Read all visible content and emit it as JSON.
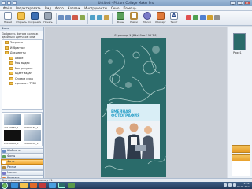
{
  "window": {
    "title": "Untitled - Picture Collage Maker Pro"
  },
  "menubar": [
    "Файл",
    "Редактировать",
    "Вид",
    "Фото",
    "Коллаж",
    "Инструменты",
    "Окно",
    "Помощь"
  ],
  "toolbar": {
    "buttons": [
      "Новый",
      "Открыть",
      "Сохранить",
      "Печать",
      "Фоны",
      "Рамки",
      "Маски",
      "Клипарт",
      "Текст"
    ]
  },
  "left_panel": {
    "header": "Фото",
    "hint": "Добавить фото в коллаж двойным щелчком или перетаскиванием",
    "tree": [
      "Загрузки",
      "Избранное",
      "Документы",
      "Adobe",
      "Мои видео",
      "Мои рисунки",
      "Будет задан",
      "Снимки с экр",
      "сделано с TTSH"
    ],
    "thumbnails": [
      "20140630_1",
      "20140630_1",
      "20140630_1",
      "20140630_1"
    ],
    "nav": [
      "Шаблоны",
      "Фоны",
      "Фото",
      "Рамки",
      "Маски",
      "Клипарт",
      "Текст"
    ]
  },
  "canvas": {
    "page_caption": "Страница 1 (81x99см / 15*20)",
    "photo_title_line1": "ЕМЕЙНАЯ",
    "photo_title_line2": "ФОТОГРАФИЯ"
  },
  "right_panel": {
    "page_label": "Page1"
  },
  "statusbar": {
    "text": "Для справки, нажмите клавишу F1"
  },
  "taskbar": {
    "time": "13:47",
    "date": "30.06.2014"
  },
  "colors": {
    "page_bg": "#2a6b6a",
    "accent": "#f0a830",
    "title_bar": "#7e9fc4"
  }
}
